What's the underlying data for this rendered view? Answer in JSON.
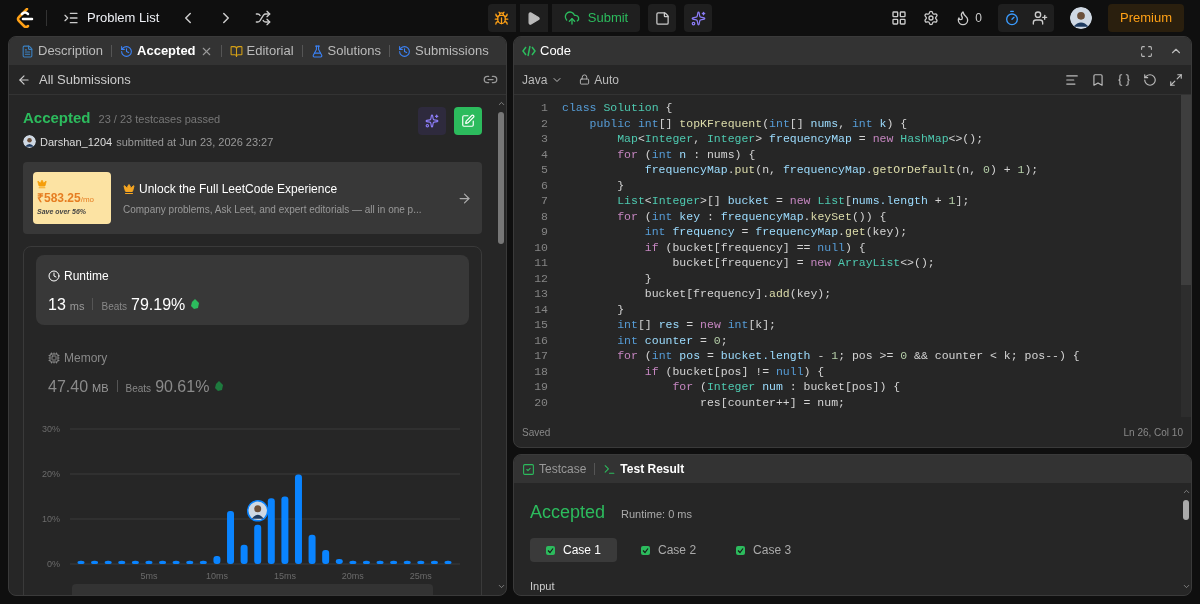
{
  "topbar": {
    "problem_list": "Problem List",
    "submit": "Submit",
    "streak": "0",
    "premium": "Premium"
  },
  "left_tabs": [
    {
      "label": "Description",
      "kind": "doc",
      "selected": false,
      "closable": false
    },
    {
      "label": "Accepted",
      "kind": "history",
      "selected": true,
      "closable": true
    },
    {
      "label": "Editorial",
      "kind": "book",
      "selected": false,
      "closable": false
    },
    {
      "label": "Solutions",
      "kind": "flask",
      "selected": false,
      "closable": false
    },
    {
      "label": "Submissions",
      "kind": "history",
      "selected": false,
      "closable": false
    }
  ],
  "back_link": "All Submissions",
  "submission": {
    "status": "Accepted",
    "testcases": "23 / 23 testcases passed",
    "user": "Darshan_1204",
    "submitted": "submitted at Jun 23, 2026 23:27"
  },
  "promo": {
    "price": "₹583.25",
    "per": "/mo",
    "save": "Save over 56%",
    "title": "Unlock the Full LeetCode Experience",
    "text": "Company problems, Ask Leet, and expert editorials — all in one p..."
  },
  "metrics": [
    {
      "label": "Runtime",
      "kind": "clock",
      "selected": true,
      "value": "13",
      "unit": "ms",
      "beats_label": "Beats",
      "beats": "79.19%"
    },
    {
      "label": "Memory",
      "kind": "chip",
      "selected": false,
      "value": "47.40",
      "unit": "MB",
      "beats_label": "Beats",
      "beats": "90.61%"
    }
  ],
  "chart_data": {
    "type": "bar",
    "x": [
      0,
      1,
      2,
      3,
      4,
      5,
      6,
      7,
      8,
      9,
      10,
      11,
      12,
      13,
      14,
      15,
      16,
      17,
      18,
      19,
      20,
      21,
      22,
      23,
      24,
      25,
      26,
      27
    ],
    "values": [
      0.7,
      0.7,
      0.7,
      0.7,
      0.7,
      0.7,
      0.7,
      0.7,
      0.7,
      0.7,
      1.8,
      11.8,
      4.3,
      8.7,
      14.6,
      15.0,
      19.9,
      6.5,
      3.1,
      1.1,
      0.7,
      0.7,
      0.7,
      0.7,
      0.7,
      0.7,
      0.7,
      0.7
    ],
    "xlim": [
      0,
      27
    ],
    "xticks": [
      {
        "value": 5,
        "label": "5ms"
      },
      {
        "value": 10,
        "label": "10ms"
      },
      {
        "value": 15,
        "label": "15ms"
      },
      {
        "value": 20,
        "label": "20ms"
      },
      {
        "value": 25,
        "label": "25ms"
      }
    ],
    "yticks": [
      {
        "value": 0,
        "label": "0%"
      },
      {
        "value": 10,
        "label": "10%"
      },
      {
        "value": 20,
        "label": "20%"
      },
      {
        "value": 30,
        "label": "30%"
      }
    ],
    "ylim": [
      0,
      30
    ]
  },
  "code_panel": {
    "title": "Code",
    "language": "Java",
    "mode": "Auto",
    "status": "Saved",
    "cursor": "Ln 26, Col 10"
  },
  "code_lines": [
    {
      "number": "1",
      "tokens": [
        {
          "kind": "keyword",
          "text": "class"
        },
        {
          "kind": "type",
          "text": " Solution"
        },
        {
          "kind": "plain",
          "text": " {"
        }
      ]
    },
    {
      "number": "2",
      "tokens": [
        {
          "kind": "keyword",
          "text": "    public int"
        },
        {
          "kind": "plain",
          "text": "[] "
        },
        {
          "kind": "function",
          "text": "topKFrequent"
        },
        {
          "kind": "plain",
          "text": "("
        },
        {
          "kind": "keyword",
          "text": "int"
        },
        {
          "kind": "plain",
          "text": "[] "
        },
        {
          "kind": "variable",
          "text": "nums"
        },
        {
          "kind": "plain",
          "text": ", "
        },
        {
          "kind": "keyword",
          "text": "int"
        },
        {
          "kind": "variable",
          "text": " k"
        },
        {
          "kind": "plain",
          "text": ") {"
        }
      ]
    },
    {
      "number": "3",
      "tokens": [
        {
          "kind": "type",
          "text": "        Map"
        },
        {
          "kind": "plain",
          "text": "<"
        },
        {
          "kind": "type",
          "text": "Integer"
        },
        {
          "kind": "plain",
          "text": ", "
        },
        {
          "kind": "type",
          "text": "Integer"
        },
        {
          "kind": "plain",
          "text": "> "
        },
        {
          "kind": "variable",
          "text": "frequencyMap"
        },
        {
          "kind": "plain",
          "text": " = "
        },
        {
          "kind": "control",
          "text": "new"
        },
        {
          "kind": "type",
          "text": " HashMap"
        },
        {
          "kind": "plain",
          "text": "<>();"
        }
      ]
    },
    {
      "number": "4",
      "tokens": [
        {
          "kind": "control",
          "text": "        for"
        },
        {
          "kind": "plain",
          "text": " ("
        },
        {
          "kind": "keyword",
          "text": "int"
        },
        {
          "kind": "variable",
          "text": " n"
        },
        {
          "kind": "plain",
          "text": " : nums) {"
        }
      ]
    },
    {
      "number": "5",
      "tokens": [
        {
          "kind": "variable",
          "text": "            frequencyMap"
        },
        {
          "kind": "plain",
          "text": "."
        },
        {
          "kind": "function",
          "text": "put"
        },
        {
          "kind": "plain",
          "text": "(n, "
        },
        {
          "kind": "variable",
          "text": "frequencyMap"
        },
        {
          "kind": "plain",
          "text": "."
        },
        {
          "kind": "function",
          "text": "getOrDefault"
        },
        {
          "kind": "plain",
          "text": "(n, "
        },
        {
          "kind": "number",
          "text": "0"
        },
        {
          "kind": "plain",
          "text": ") + "
        },
        {
          "kind": "number",
          "text": "1"
        },
        {
          "kind": "plain",
          "text": ");"
        }
      ]
    },
    {
      "number": "6",
      "tokens": [
        {
          "kind": "plain",
          "text": "        }"
        }
      ]
    },
    {
      "number": "7",
      "tokens": [
        {
          "kind": "type",
          "text": "        List"
        },
        {
          "kind": "plain",
          "text": "<"
        },
        {
          "kind": "type",
          "text": "Integer"
        },
        {
          "kind": "plain",
          "text": ">[] "
        },
        {
          "kind": "variable",
          "text": "bucket"
        },
        {
          "kind": "plain",
          "text": " = "
        },
        {
          "kind": "control",
          "text": "new"
        },
        {
          "kind": "type",
          "text": " List"
        },
        {
          "kind": "plain",
          "text": "["
        },
        {
          "kind": "variable",
          "text": "nums.length"
        },
        {
          "kind": "plain",
          "text": " + "
        },
        {
          "kind": "number",
          "text": "1"
        },
        {
          "kind": "plain",
          "text": "];"
        }
      ]
    },
    {
      "number": "8",
      "tokens": [
        {
          "kind": "control",
          "text": "        for"
        },
        {
          "kind": "plain",
          "text": " ("
        },
        {
          "kind": "keyword",
          "text": "int"
        },
        {
          "kind": "variable",
          "text": " key"
        },
        {
          "kind": "plain",
          "text": " : "
        },
        {
          "kind": "variable",
          "text": "frequencyMap"
        },
        {
          "kind": "plain",
          "text": "."
        },
        {
          "kind": "function",
          "text": "keySet"
        },
        {
          "kind": "plain",
          "text": "()) {"
        }
      ]
    },
    {
      "number": "9",
      "tokens": [
        {
          "kind": "keyword",
          "text": "            int"
        },
        {
          "kind": "variable",
          "text": " frequency"
        },
        {
          "kind": "plain",
          "text": " = "
        },
        {
          "kind": "variable",
          "text": "frequencyMap"
        },
        {
          "kind": "plain",
          "text": "."
        },
        {
          "kind": "function",
          "text": "get"
        },
        {
          "kind": "plain",
          "text": "(key);"
        }
      ]
    },
    {
      "number": "10",
      "tokens": [
        {
          "kind": "control",
          "text": "            if"
        },
        {
          "kind": "plain",
          "text": " (bucket[frequency] == "
        },
        {
          "kind": "keyword",
          "text": "null"
        },
        {
          "kind": "plain",
          "text": ") {"
        }
      ]
    },
    {
      "number": "11",
      "tokens": [
        {
          "kind": "plain",
          "text": "                bucket[frequency] = "
        },
        {
          "kind": "control",
          "text": "new"
        },
        {
          "kind": "type",
          "text": " ArrayList"
        },
        {
          "kind": "plain",
          "text": "<>();"
        }
      ]
    },
    {
      "number": "12",
      "tokens": [
        {
          "kind": "plain",
          "text": "            }"
        }
      ]
    },
    {
      "number": "13",
      "tokens": [
        {
          "kind": "plain",
          "text": "            bucket[frequency]."
        },
        {
          "kind": "function",
          "text": "add"
        },
        {
          "kind": "plain",
          "text": "(key);"
        }
      ]
    },
    {
      "number": "14",
      "tokens": [
        {
          "kind": "plain",
          "text": "        }"
        }
      ]
    },
    {
      "number": "15",
      "tokens": [
        {
          "kind": "keyword",
          "text": "        int"
        },
        {
          "kind": "plain",
          "text": "[] "
        },
        {
          "kind": "variable",
          "text": "res"
        },
        {
          "kind": "plain",
          "text": " = "
        },
        {
          "kind": "control",
          "text": "new"
        },
        {
          "kind": "keyword",
          "text": " int"
        },
        {
          "kind": "plain",
          "text": "[k];"
        }
      ]
    },
    {
      "number": "16",
      "tokens": [
        {
          "kind": "keyword",
          "text": "        int"
        },
        {
          "kind": "variable",
          "text": " counter"
        },
        {
          "kind": "plain",
          "text": " = "
        },
        {
          "kind": "number",
          "text": "0"
        },
        {
          "kind": "plain",
          "text": ";"
        }
      ]
    },
    {
      "number": "17",
      "tokens": [
        {
          "kind": "control",
          "text": "        for"
        },
        {
          "kind": "plain",
          "text": " ("
        },
        {
          "kind": "keyword",
          "text": "int"
        },
        {
          "kind": "variable",
          "text": " pos"
        },
        {
          "kind": "plain",
          "text": " = "
        },
        {
          "kind": "variable",
          "text": "bucket.length"
        },
        {
          "kind": "plain",
          "text": " - "
        },
        {
          "kind": "number",
          "text": "1"
        },
        {
          "kind": "plain",
          "text": "; pos >= "
        },
        {
          "kind": "number",
          "text": "0"
        },
        {
          "kind": "plain",
          "text": " && counter < k; pos--) {"
        }
      ]
    },
    {
      "number": "18",
      "tokens": [
        {
          "kind": "control",
          "text": "            if"
        },
        {
          "kind": "plain",
          "text": " (bucket[pos] != "
        },
        {
          "kind": "keyword",
          "text": "null"
        },
        {
          "kind": "plain",
          "text": ") {"
        }
      ]
    },
    {
      "number": "19",
      "tokens": [
        {
          "kind": "control",
          "text": "                for"
        },
        {
          "kind": "plain",
          "text": " ("
        },
        {
          "kind": "type",
          "text": "Integer"
        },
        {
          "kind": "variable",
          "text": " num"
        },
        {
          "kind": "plain",
          "text": " : bucket[pos]) {"
        }
      ]
    },
    {
      "number": "20",
      "tokens": [
        {
          "kind": "plain",
          "text": "                    res[counter++] = num;"
        }
      ]
    }
  ],
  "bottom_tabs": [
    {
      "label": "Testcase",
      "kind": "check",
      "selected": false
    },
    {
      "label": "Test Result",
      "kind": "terminal",
      "selected": true
    }
  ],
  "result": {
    "status": "Accepted",
    "runtime": "Runtime: 0 ms"
  },
  "cases": [
    {
      "label": "Case 1",
      "selected": true,
      "passed": true
    },
    {
      "label": "Case 2",
      "selected": false,
      "passed": true
    },
    {
      "label": "Case 3",
      "selected": false,
      "passed": true
    }
  ],
  "input_label": "Input"
}
